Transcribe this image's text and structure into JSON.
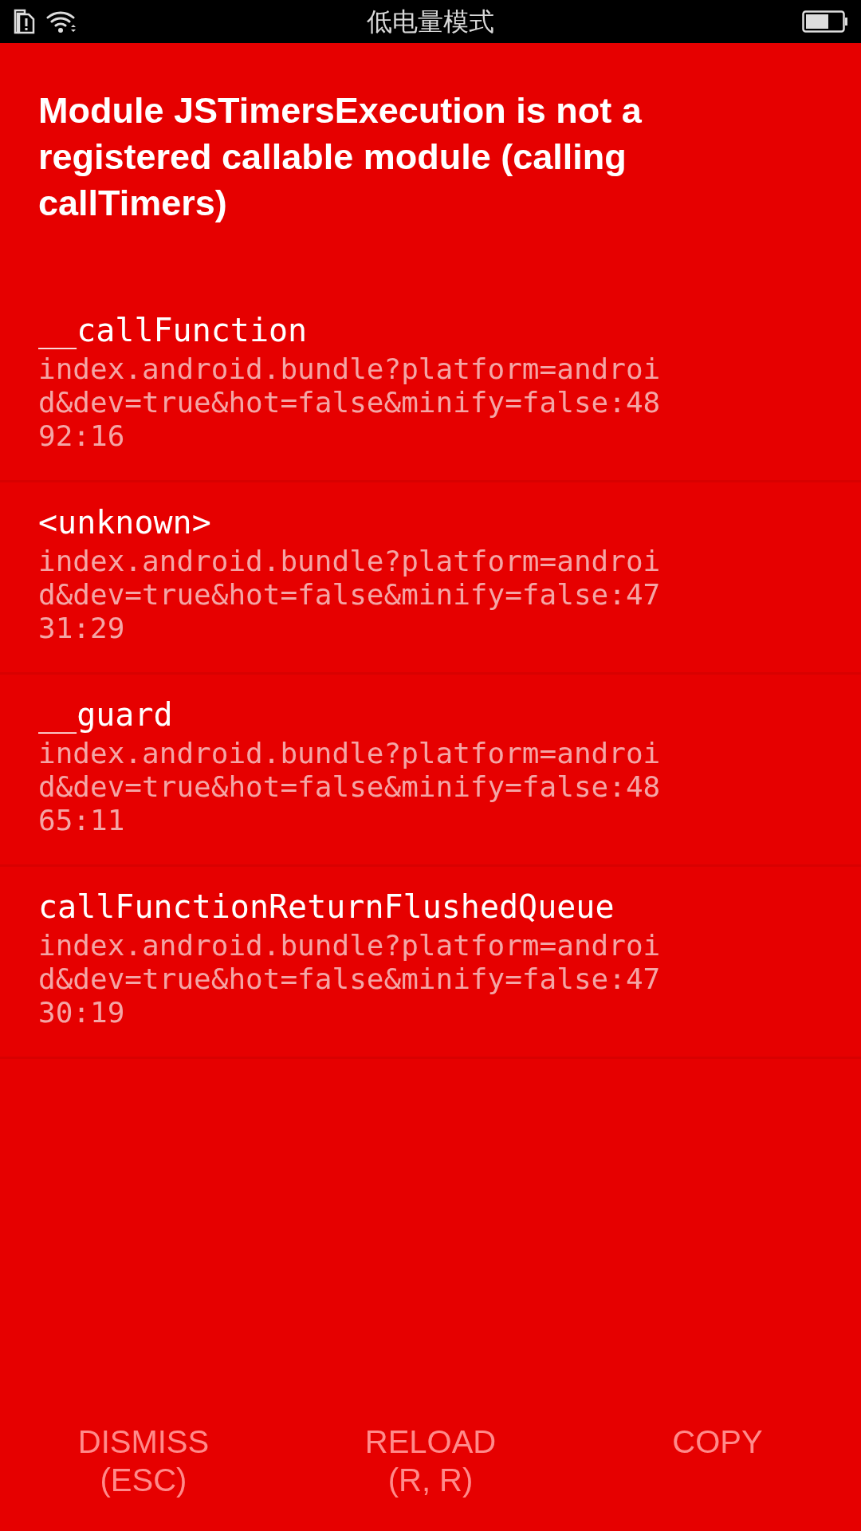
{
  "status_bar": {
    "title": "低电量模式"
  },
  "error": {
    "message": "Module JSTimersExecution is not a registered callable module (calling callTimers)"
  },
  "stack": [
    {
      "method": "__callFunction",
      "location": "index.android.bundle?platform=android&dev=true&hot=false&minify=false:4892:16"
    },
    {
      "method": "<unknown>",
      "location": "index.android.bundle?platform=android&dev=true&hot=false&minify=false:4731:29"
    },
    {
      "method": "__guard",
      "location": "index.android.bundle?platform=android&dev=true&hot=false&minify=false:4865:11"
    },
    {
      "method": "callFunctionReturnFlushedQueue",
      "location": "index.android.bundle?platform=android&dev=true&hot=false&minify=false:4730:19"
    }
  ],
  "buttons": [
    {
      "label": "DISMISS\n(ESC)"
    },
    {
      "label": "RELOAD\n(R, R)"
    },
    {
      "label": "COPY"
    }
  ]
}
